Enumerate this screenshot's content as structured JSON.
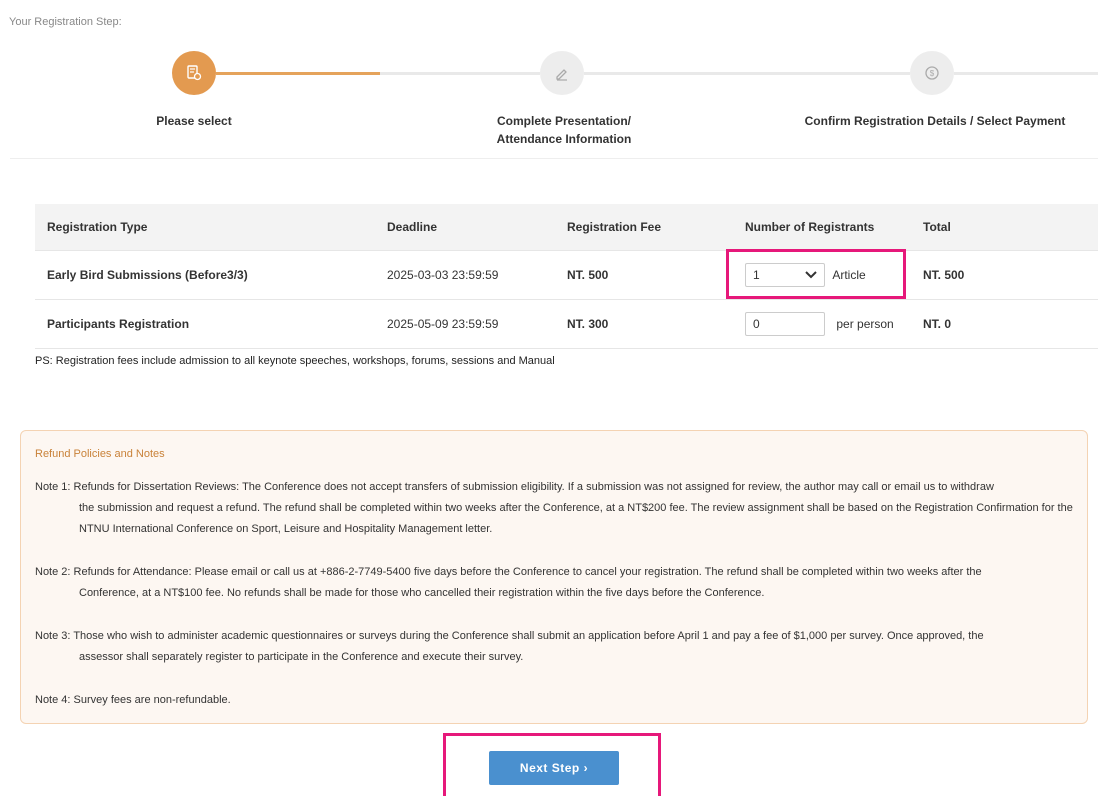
{
  "step_heading": "Your Registration Step:",
  "steps": [
    {
      "label": "Please select",
      "icon": "document-settings-icon",
      "active": true
    },
    {
      "label": "Complete Presentation/\nAttendance Information",
      "icon": "pencil-icon",
      "active": false
    },
    {
      "label": "Confirm Registration Details / Select Payment",
      "icon": "dollar-coin-icon",
      "active": false
    }
  ],
  "table": {
    "headers": [
      "Registration Type",
      "Deadline",
      "Registration Fee",
      "Number of Registrants",
      "Total"
    ],
    "rows": [
      {
        "type": "Early Bird Submissions (Before3/3)",
        "deadline": "2025-03-03 23:59:59",
        "fee": "NT. 500",
        "count": "1",
        "unit": "Article",
        "total": "NT. 500"
      },
      {
        "type": "Participants Registration",
        "deadline": "2025-05-09 23:59:59",
        "fee": "NT. 300",
        "count": "0",
        "unit": "per person",
        "total": "NT. 0"
      }
    ]
  },
  "ps_note": "PS: Registration fees include admission to all keynote speeches, workshops, forums, sessions and Manual",
  "refund": {
    "title": "Refund Policies and Notes",
    "notes": [
      {
        "label": "Note 1:",
        "line1": "Refunds for Dissertation Reviews: The Conference does not accept transfers of submission eligibility. If a submission was not assigned for review, the author may call or email us to withdraw",
        "rest": "the submission and request a refund. The refund shall be completed within two weeks after the Conference, at a NT$200 fee. The review assignment shall be based on the Registration Confirmation for the NTNU International Conference on Sport, Leisure and Hospitality Management letter."
      },
      {
        "label": "Note 2:",
        "line1": "Refunds for Attendance: Please email or call us at +886-2-7749-5400 five days before the Conference to cancel your registration. The refund shall be completed within two weeks after the",
        "rest": "Conference, at a NT$100 fee. No refunds shall be made for those who cancelled their registration within the five days before the Conference."
      },
      {
        "label": "Note 3:",
        "line1": "Those who wish to administer academic questionnaires or surveys during the Conference shall submit an application before April 1 and pay a fee of $1,000 per survey. Once approved, the",
        "rest": "assessor shall separately register to participate in the Conference and execute their survey."
      },
      {
        "label": "Note 4:",
        "line1": "Survey fees are non-refundable.",
        "rest": ""
      }
    ]
  },
  "next_button": "Next Step ›",
  "colors": {
    "accent": "#e39a50",
    "button": "#4a90cf",
    "highlight": "#e6187a"
  }
}
